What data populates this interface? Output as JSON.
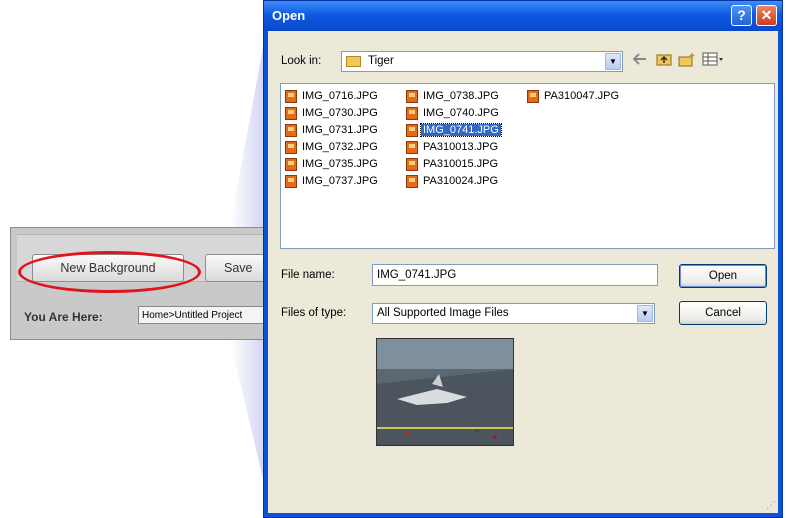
{
  "background_app": {
    "new_background_label": "New Background",
    "save_label": "Save",
    "you_are_here_label": "You Are Here:",
    "you_are_here_value": "Home>Untitled Project"
  },
  "dialog": {
    "title": "Open",
    "help_glyph": "?",
    "close_glyph": "✕",
    "look_in_label": "Look in:",
    "look_in_value": "Tiger",
    "file_name_label": "File name:",
    "file_name_value": "IMG_0741.JPG",
    "files_of_type_label": "Files of type:",
    "files_of_type_value": "All Supported Image Files",
    "open_label": "Open",
    "cancel_label": "Cancel",
    "files": [
      "IMG_0716.JPG",
      "IMG_0730.JPG",
      "IMG_0731.JPG",
      "IMG_0732.JPG",
      "IMG_0735.JPG",
      "IMG_0737.JPG",
      "IMG_0738.JPG",
      "IMG_0740.JPG",
      "IMG_0741.JPG",
      "PA310013.JPG",
      "PA310015.JPG",
      "PA310024.JPG",
      "PA310047.JPG"
    ],
    "selected_file": "IMG_0741.JPG",
    "icons": [
      "folder-icon",
      "back-arrow-icon",
      "up-folder-icon",
      "new-folder-icon",
      "view-menu-icon",
      "jpg-file-icon"
    ]
  },
  "colors": {
    "title_bar": "#0f5ae3",
    "selection": "#316ac5",
    "highlight_ellipse": "#e0141c",
    "dialog_face": "#ece9d8"
  }
}
